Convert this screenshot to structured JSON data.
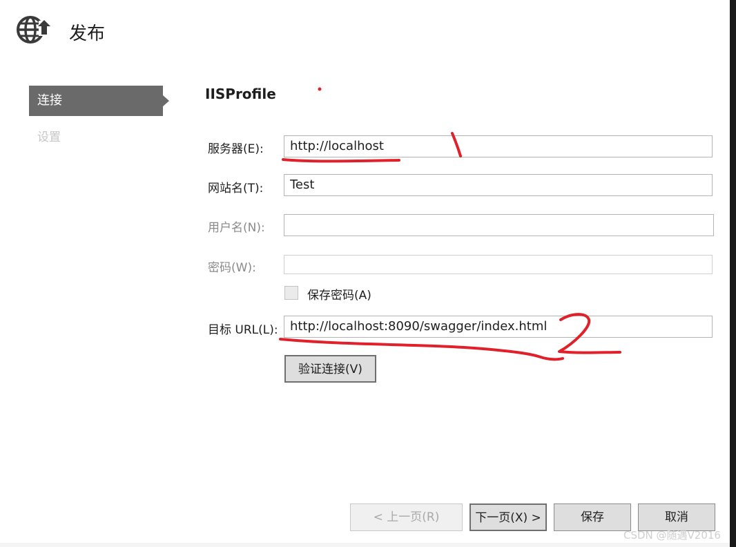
{
  "window": {
    "title": "发布",
    "header_icon": "globe-publish-icon"
  },
  "nav": {
    "items": [
      {
        "label": "连接",
        "state": "active"
      },
      {
        "label": "设置",
        "state": "disabled"
      }
    ]
  },
  "profile": {
    "name": "IISProfile"
  },
  "form": {
    "server": {
      "label": "服务器(E):",
      "value": "http://localhost"
    },
    "site": {
      "label": "网站名(T):",
      "value": "Test"
    },
    "username": {
      "label": "用户名(N):",
      "value": ""
    },
    "password": {
      "label": "密码(W):",
      "value": ""
    },
    "save_password": {
      "label": "保存密码(A)",
      "checked": false
    },
    "target_url": {
      "label": "目标 URL(L):",
      "value": "http://localhost:8090/swagger/index.html"
    },
    "verify_button": "验证连接(V)"
  },
  "footer": {
    "prev": "< 上一页(R)",
    "next": "下一页(X) >",
    "save": "保存",
    "cancel": "取消"
  },
  "annotations": {
    "mark1": "1",
    "mark2": "2",
    "color": "#e0202a"
  },
  "watermark": "CSDN @随遇V2016"
}
